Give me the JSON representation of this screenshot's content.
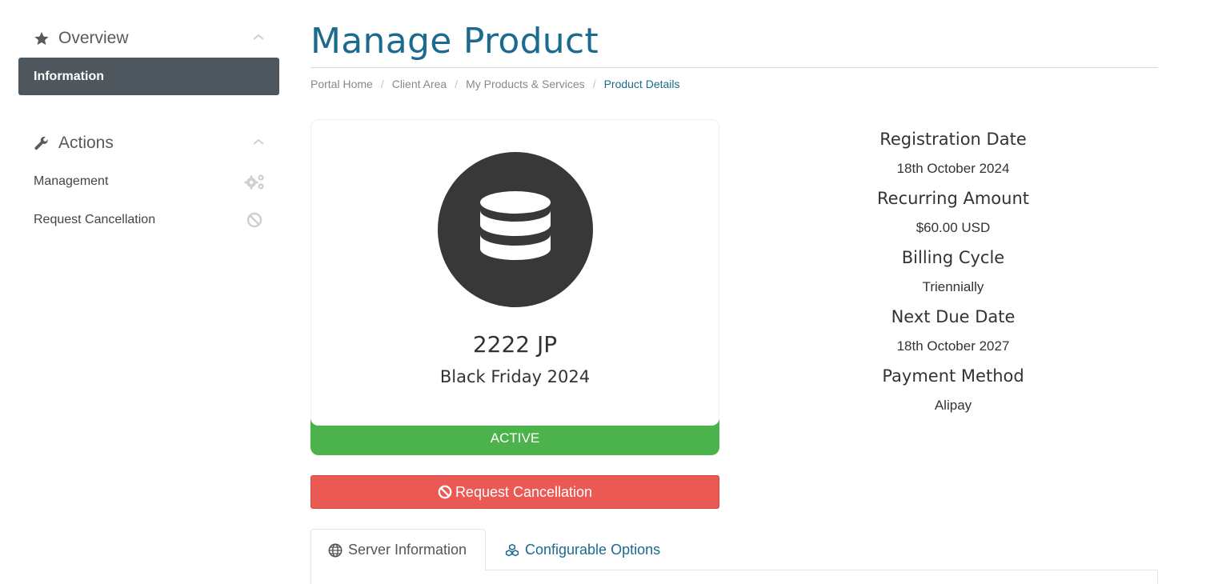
{
  "page": {
    "title": "Manage Product"
  },
  "breadcrumb": [
    "Portal Home",
    "Client Area",
    "My Products & Services",
    "Product Details"
  ],
  "sidebar": {
    "overview": {
      "title": "Overview",
      "icon": "star-icon",
      "items": [
        {
          "label": "Information",
          "active": true
        }
      ]
    },
    "actions": {
      "title": "Actions",
      "icon": "wrench-icon",
      "items": [
        {
          "label": "Management",
          "icon": "gears-icon"
        },
        {
          "label": "Request Cancellation",
          "icon": "ban-icon"
        }
      ]
    }
  },
  "product": {
    "icon": "database-icon",
    "name": "2222 JP",
    "group": "Black Friday 2024",
    "status": "ACTIVE",
    "cancel_label": "Request Cancellation"
  },
  "details": [
    {
      "label": "Registration Date",
      "value": "18th October 2024"
    },
    {
      "label": "Recurring Amount",
      "value": "$60.00 USD"
    },
    {
      "label": "Billing Cycle",
      "value": "Triennially"
    },
    {
      "label": "Next Due Date",
      "value": "18th October 2027"
    },
    {
      "label": "Payment Method",
      "value": "Alipay"
    }
  ],
  "tabs": [
    {
      "label": "Server Information",
      "icon": "globe-icon",
      "active": true
    },
    {
      "label": "Configurable Options",
      "icon": "cubes-icon",
      "active": false
    }
  ],
  "colors": {
    "brand": "#1b6a8f",
    "status_active": "#4cb34c",
    "danger": "#ea5954",
    "sidebar_active": "#4e575d"
  }
}
